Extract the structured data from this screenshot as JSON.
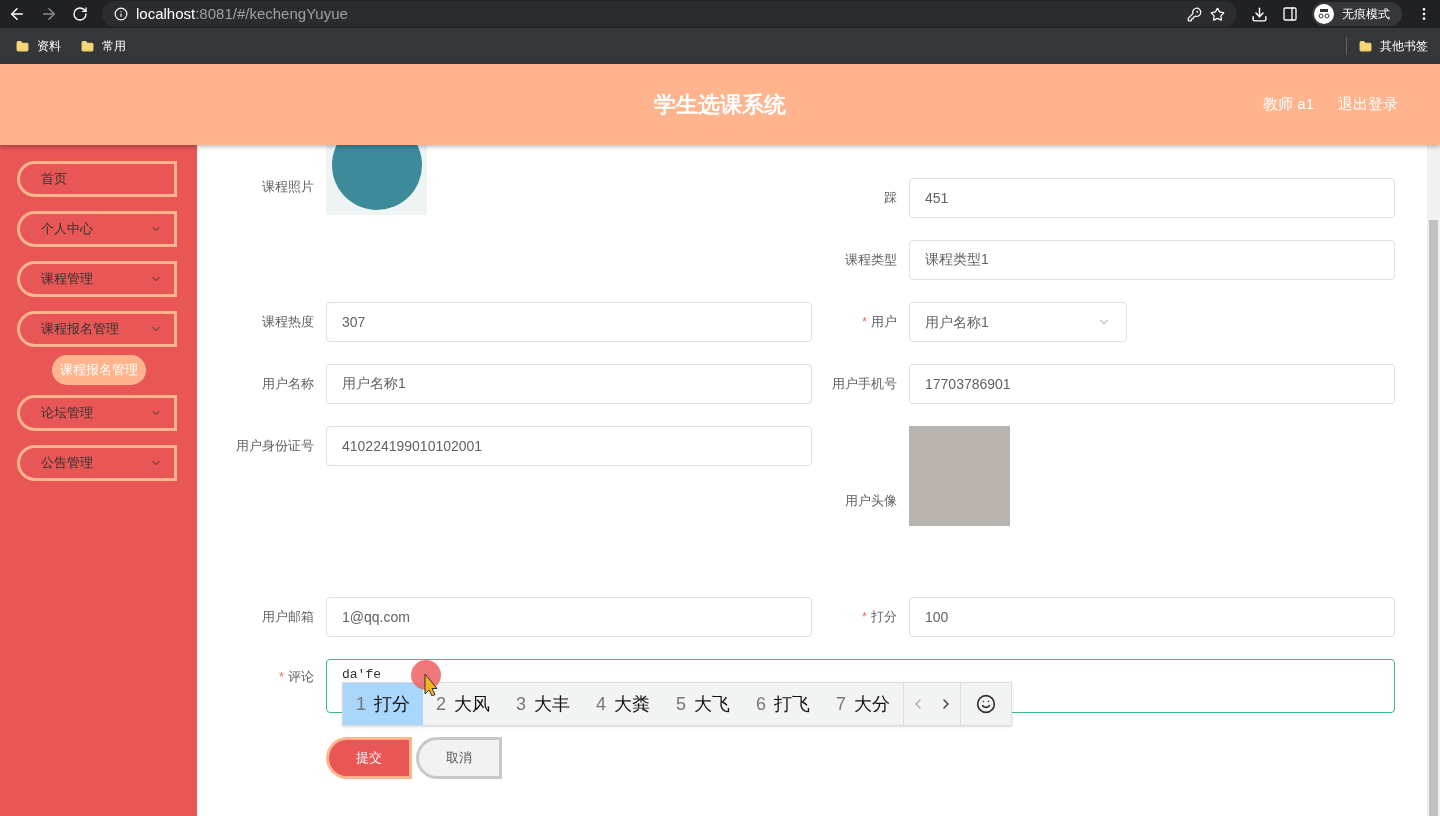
{
  "browser": {
    "url_host": "localhost",
    "url_rest": ":8081/#/kechengYuyue",
    "profile_label": "无痕模式",
    "bookmarks": [
      "资料",
      "常用"
    ],
    "other_bookmarks": "其他书签"
  },
  "header": {
    "title": "学生选课系统",
    "user": "教师 a1",
    "logout": "退出登录"
  },
  "sidebar": [
    {
      "label": "首页",
      "kind": "link"
    },
    {
      "label": "个人中心",
      "kind": "submenu"
    },
    {
      "label": "课程管理",
      "kind": "submenu"
    },
    {
      "label": "课程报名管理",
      "kind": "submenu",
      "children": [
        {
          "label": "课程报名管理",
          "selected": true
        }
      ]
    },
    {
      "label": "论坛管理",
      "kind": "submenu"
    },
    {
      "label": "公告管理",
      "kind": "submenu"
    }
  ],
  "form": {
    "rows": [
      {
        "left": {
          "label": "课程照片",
          "kind": "image"
        },
        "right": {
          "label": "踩",
          "kind": "text",
          "value": "451"
        }
      },
      {
        "right": {
          "label": "课程类型",
          "kind": "text",
          "value": "课程类型1"
        }
      },
      {
        "left": {
          "label": "课程热度",
          "kind": "text",
          "value": "307"
        },
        "right": {
          "label": "用户",
          "kind": "select",
          "value": "用户名称1",
          "required_mark": "*"
        }
      },
      {
        "left": {
          "label": "用户名称",
          "kind": "text",
          "value": "用户名称1"
        },
        "right": {
          "label": "用户手机号",
          "kind": "text",
          "value": "17703786901"
        }
      },
      {
        "left": {
          "label": "用户身份证号",
          "kind": "text",
          "value": "410224199010102001"
        },
        "right": {
          "label": "用户头像",
          "kind": "photo"
        }
      },
      {
        "left": {
          "label": "用户邮箱",
          "kind": "text",
          "value": "1@qq.com"
        },
        "right": {
          "label": "打分",
          "kind": "text",
          "value": "100",
          "required_mark": "*"
        }
      }
    ],
    "comment": {
      "label": "评论",
      "value": "da'fe",
      "required_mark": "*",
      "focused": true
    },
    "buttons": [
      {
        "label": "提交",
        "kind": "primary"
      },
      {
        "label": "取消",
        "kind": "secondary"
      }
    ]
  },
  "ime": {
    "candidates": [
      {
        "number": "1",
        "text": "打分",
        "selected": true
      },
      {
        "number": "2",
        "text": "大风",
        "selected": false
      },
      {
        "number": "3",
        "text": "大丰",
        "selected": false
      },
      {
        "number": "4",
        "text": "大粪",
        "selected": false
      },
      {
        "number": "5",
        "text": "大飞",
        "selected": false
      },
      {
        "number": "6",
        "text": "打飞",
        "selected": false
      },
      {
        "number": "7",
        "text": "大分",
        "selected": false
      }
    ]
  }
}
